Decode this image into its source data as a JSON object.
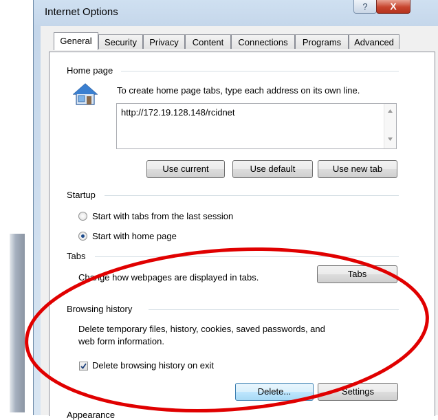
{
  "window": {
    "title": "Internet Options",
    "help_glyph": "?",
    "close_glyph": "X"
  },
  "tabs": [
    {
      "label": "General"
    },
    {
      "label": "Security"
    },
    {
      "label": "Privacy"
    },
    {
      "label": "Content"
    },
    {
      "label": "Connections"
    },
    {
      "label": "Programs"
    },
    {
      "label": "Advanced"
    }
  ],
  "home_page": {
    "group_label": "Home page",
    "instruction": "To create home page tabs, type each address on its own line.",
    "address": "http://172.19.128.148/rcidnet",
    "use_current": "Use current",
    "use_default": "Use default",
    "use_new_tab": "Use new tab",
    "icon": "house-icon"
  },
  "startup": {
    "group_label": "Startup",
    "option_last_session": "Start with tabs from the last session",
    "option_home_page": "Start with home page",
    "selected": "Start with home page"
  },
  "tabs_section": {
    "group_label": "Tabs",
    "description": "Change how webpages are displayed in tabs.",
    "button_label": "Tabs"
  },
  "browsing_history": {
    "group_label": "Browsing history",
    "description_line1": "Delete temporary files, history, cookies, saved passwords, and",
    "description_line2": "web form information.",
    "checkbox_label": "Delete browsing history on exit",
    "checkbox_checked": true,
    "delete_button": "Delete...",
    "settings_button": "Settings"
  },
  "appearance": {
    "group_label": "Appearance"
  },
  "colors": {
    "annotation_oval": "#e00000",
    "radio_dot": "#1c4b8c"
  }
}
